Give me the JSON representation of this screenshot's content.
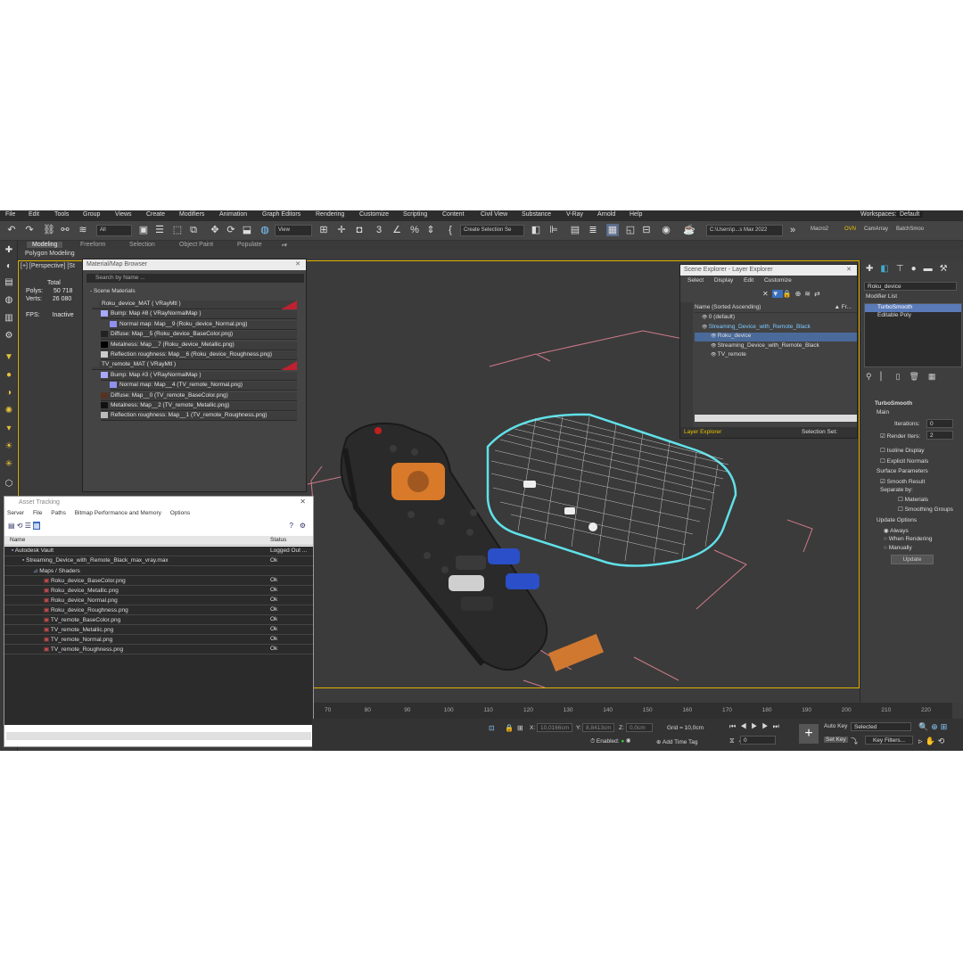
{
  "menu": [
    "File",
    "Edit",
    "Tools",
    "Group",
    "Views",
    "Create",
    "Modifiers",
    "Animation",
    "Graph Editors",
    "Rendering",
    "Customize",
    "Scripting",
    "Content",
    "Civil View",
    "Substance",
    "V-Ray",
    "Arnold",
    "Help"
  ],
  "workspace": {
    "label": "Workspaces:",
    "value": "Default"
  },
  "toolbar": {
    "filter_all": "All",
    "view_dropdown": "View",
    "selection_set": "Create Selection Se",
    "path": "C:\\Users\\p...s Max 2022",
    "macro2": "Macro2",
    "ovn": "OVN",
    "camarray": "CamArray",
    "batchsmoo": "BatchSmoo"
  },
  "ribbon": {
    "tabs": [
      "Modeling",
      "Freeform",
      "Selection",
      "Object Paint",
      "Populate"
    ],
    "sub": "Polygon Modeling"
  },
  "viewport": {
    "label": "[+] [Perspective] [St",
    "stats": {
      "total": "Total",
      "polys_label": "Polys:",
      "polys": "50 718",
      "verts_label": "Verts:",
      "verts": "26 080",
      "fps_label": "FPS:",
      "fps": "Inactive"
    }
  },
  "material_browser": {
    "title": "Material/Map Browser",
    "search_placeholder": "Search by Name ...",
    "section": "- Scene Materials",
    "items": [
      {
        "text": "Roku_device_MAT  ( VRayMtl )",
        "level": 0,
        "swatch": "#444444",
        "flag": true
      },
      {
        "text": "Bump: Map #8  ( VRayNormalMap )",
        "level": 1,
        "swatch": "#a8a8ff"
      },
      {
        "text": "Normal map: Map__9 (Roku_device_Normal.png)",
        "level": 2,
        "swatch": "#9090ee"
      },
      {
        "text": "Diffuse: Map__5 (Roku_device_BaseColor.png)",
        "level": 1,
        "swatch": "#222222"
      },
      {
        "text": "Metalness: Map__7 (Roku_device_Metallic.png)",
        "level": 1,
        "swatch": "#000000"
      },
      {
        "text": "Reflection roughness: Map__6 (Roku_device_Roughness.png)",
        "level": 1,
        "swatch": "#cccccc"
      },
      {
        "text": "TV_remote_MAT  ( VRayMtl )",
        "level": 0,
        "swatch": "#444444",
        "flag": true
      },
      {
        "text": "Bump: Map #3  ( VRayNormalMap )",
        "level": 1,
        "swatch": "#a8a8ff"
      },
      {
        "text": "Normal map: Map__4 (TV_remote_Normal.png)",
        "level": 2,
        "swatch": "#9090ee"
      },
      {
        "text": "Diffuse: Map__0 (TV_remote_BaseColor.png)",
        "level": 1,
        "swatch": "#553322"
      },
      {
        "text": "Metalness: Map__2 (TV_remote_Metallic.png)",
        "level": 1,
        "swatch": "#111111"
      },
      {
        "text": "Reflection roughness: Map__1 (TV_remote_Roughness.png)",
        "level": 1,
        "swatch": "#bbbbbb"
      }
    ]
  },
  "asset_tracking": {
    "title": "Asset Tracking",
    "menu": [
      "Server",
      "File",
      "Paths",
      "Bitmap Performance and Memory",
      "Options"
    ],
    "columns": [
      "Name",
      "Status"
    ],
    "rows": [
      {
        "name": "Autodesk Vault",
        "status": "Logged Out ...",
        "indent": 0
      },
      {
        "name": "Streaming_Device_with_Remote_Black_max_vray.max",
        "status": "Ok",
        "indent": 1
      },
      {
        "name": "Maps / Shaders",
        "status": "",
        "indent": 2
      },
      {
        "name": "Roku_device_BaseColor.png",
        "status": "Ok",
        "indent": 3
      },
      {
        "name": "Roku_device_Metallic.png",
        "status": "Ok",
        "indent": 3
      },
      {
        "name": "Roku_device_Normal.png",
        "status": "Ok",
        "indent": 3
      },
      {
        "name": "Roku_device_Roughness.png",
        "status": "Ok",
        "indent": 3
      },
      {
        "name": "TV_remote_BaseColor.png",
        "status": "Ok",
        "indent": 3
      },
      {
        "name": "TV_remote_Metallic.png",
        "status": "Ok",
        "indent": 3
      },
      {
        "name": "TV_remote_Normal.png",
        "status": "Ok",
        "indent": 3
      },
      {
        "name": "TV_remote_Roughness.png",
        "status": "Ok",
        "indent": 3
      }
    ]
  },
  "scene_explorer": {
    "title": "Scene Explorer - Layer Explorer",
    "menu": [
      "Select",
      "Display",
      "Edit",
      "Customize"
    ],
    "header": "Name (Sorted Ascending)",
    "header_right": "▲ Fr...",
    "items": [
      {
        "name": "0 (default)",
        "indent": 0
      },
      {
        "name": "Streaming_Device_with_Remote_Black",
        "indent": 0,
        "highlight": true
      },
      {
        "name": "Roku_device",
        "indent": 1,
        "selected": true
      },
      {
        "name": "Streaming_Device_with_Remote_Black",
        "indent": 1
      },
      {
        "name": "TV_remote",
        "indent": 1
      }
    ],
    "footer_left": "Layer Explorer",
    "footer_right": "Selection Set:"
  },
  "command_panel": {
    "object_name": "Roku_device",
    "modifier_list": "Modifier List",
    "stack": [
      "TurboSmooth",
      "Editable Poly"
    ],
    "rollout_title": "TurboSmooth",
    "main": "Main",
    "iterations_label": "Iterations:",
    "iterations": "0",
    "render_iters_label": "Render Iters:",
    "render_iters": "2",
    "isoline": "Isoline Display",
    "explicit": "Explicit Normals",
    "surface_params": "Surface Parameters",
    "smooth_result": "Smooth Result",
    "separate_by": "Separate by:",
    "materials": "Materials",
    "smoothing_groups": "Smoothing Groups",
    "update_options": "Update Options",
    "always": "Always",
    "when_rendering": "When Rendering",
    "manually": "Manually",
    "update_btn": "Update"
  },
  "timeline": {
    "ticks": [
      "70",
      "80",
      "90",
      "100",
      "110",
      "120",
      "130",
      "140",
      "150",
      "160",
      "170",
      "180",
      "190",
      "200",
      "210",
      "220"
    ]
  },
  "statusbar": {
    "x_label": "X:",
    "x": "10,0166cm",
    "y_label": "Y:",
    "y": "8,8413cm",
    "z_label": "Z:",
    "z": "0,0cm",
    "grid": "Grid = 10,0cm",
    "enabled": "Enabled:",
    "add_time_tag": "Add Time Tag",
    "auto_key": "Auto Key",
    "selected": "Selected",
    "set_key": "Set Key",
    "key_filters": "Key Filters...",
    "frame": "0"
  }
}
